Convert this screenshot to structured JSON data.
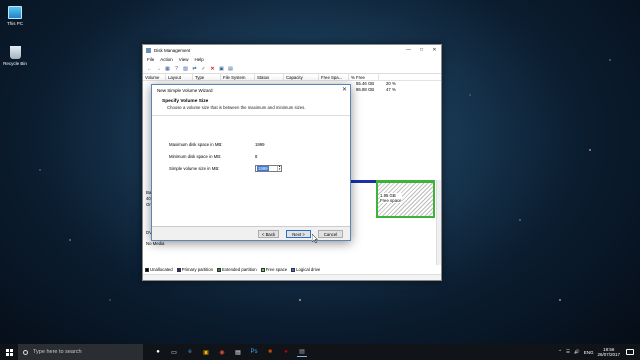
{
  "desktop": {
    "icons": [
      {
        "label": "This PC",
        "icon": "this-pc-icon"
      },
      {
        "label": "Recycle Bin",
        "icon": "recycle-bin-icon"
      }
    ]
  },
  "disk_management": {
    "title": "Disk Management",
    "menu": [
      "File",
      "Action",
      "View",
      "Help"
    ],
    "columns": [
      "Volume",
      "Layout",
      "Type",
      "File System",
      "Status",
      "Capacity",
      "Free Spa...",
      "% Free"
    ],
    "rows": [
      {
        "free": "55.46 GB",
        "pct": "20 %"
      },
      {
        "free": "86.88 GB",
        "pct": "47 %"
      }
    ],
    "disk_labels": [
      "Ba",
      "40",
      "On",
      "DV",
      "No Media"
    ],
    "free_partition": {
      "size": "1.95 GB",
      "label": "Free space"
    },
    "legend": [
      {
        "label": "Unallocated",
        "color": "#000000"
      },
      {
        "label": "Primary partition",
        "color": "#1a31a8"
      },
      {
        "label": "Extended partition",
        "color": "#2c8a2c"
      },
      {
        "label": "Free space",
        "color": "#57d14f"
      },
      {
        "label": "Logical drive",
        "color": "#3b6fd6"
      }
    ]
  },
  "wizard": {
    "title": "New Simple Volume Wizard",
    "heading": "Specify Volume Size",
    "subheading": "Choose a volume size that is between the maximum and minimum sizes.",
    "max_label": "Maximum disk space in MB:",
    "max_value": "1999",
    "min_label": "Minimum disk space in MB:",
    "min_value": "8",
    "size_label": "Simple volume size in MB:",
    "size_value": "1999",
    "back_button": "< Back",
    "next_button": "Next >",
    "cancel_button": "Cancel"
  },
  "taskbar": {
    "search_placeholder": "Type here to search",
    "language": "ENG",
    "time": "18:56",
    "date": "26/07/2017"
  }
}
